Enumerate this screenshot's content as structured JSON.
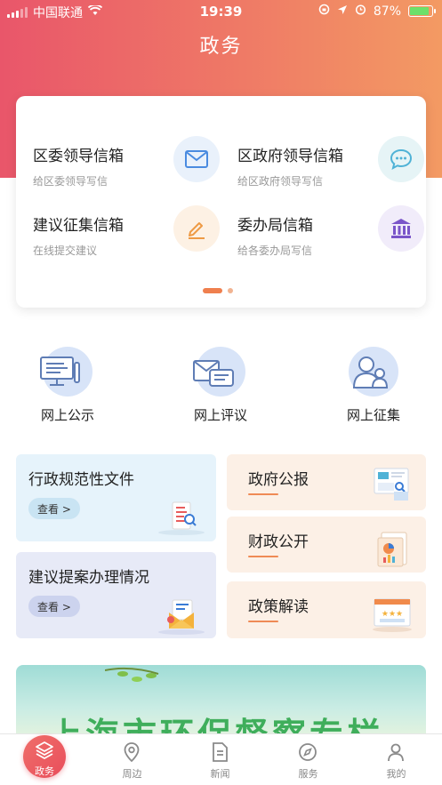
{
  "status_bar": {
    "carrier": "中国联通",
    "time": "19:39",
    "battery": "87%",
    "battery_level": 0.87
  },
  "header": {
    "title": "政务"
  },
  "mailboxes": [
    {
      "title": "区委领导信箱",
      "subtitle": "给区委领导写信",
      "icon": "envelope-icon"
    },
    {
      "title": "区政府领导信箱",
      "subtitle": "给区政府领导写信",
      "icon": "chat-bubble-icon"
    },
    {
      "title": "建议征集信箱",
      "subtitle": "在线提交建议",
      "icon": "pencil-icon"
    },
    {
      "title": "委办局信箱",
      "subtitle": "给各委办局写信",
      "icon": "government-building-icon"
    }
  ],
  "carousel": {
    "pages": 2,
    "active": 1
  },
  "quick_links": [
    {
      "label": "网上公示",
      "icon": "monitor-icon"
    },
    {
      "label": "网上评议",
      "icon": "message-envelope-icon"
    },
    {
      "label": "网上征集",
      "icon": "people-icon"
    }
  ],
  "tiles": {
    "regulations": {
      "title": "行政规范性文件",
      "button": "查看 >"
    },
    "proposals": {
      "title": "建议提案办理情况",
      "button": "查看 >"
    },
    "gazette": {
      "title": "政府公报"
    },
    "finance": {
      "title": "财政公开"
    },
    "policy": {
      "title": "政策解读"
    }
  },
  "banner": {
    "text": "上海市环保督察专栏"
  },
  "tabbar": [
    {
      "label": "政务",
      "icon": "layers-icon",
      "active": true
    },
    {
      "label": "周边",
      "icon": "location-pin-icon"
    },
    {
      "label": "新闻",
      "icon": "document-icon"
    },
    {
      "label": "服务",
      "icon": "compass-icon"
    },
    {
      "label": "我的",
      "icon": "person-icon"
    }
  ],
  "colors": {
    "accent": "#ef7f4e",
    "header_start": "#e9566a",
    "header_end": "#f39a63"
  }
}
